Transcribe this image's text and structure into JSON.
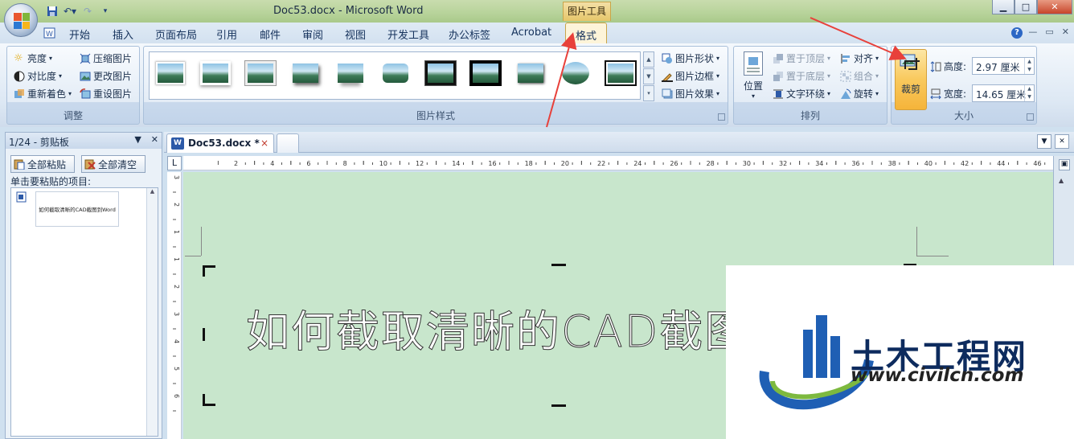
{
  "window": {
    "title": "Doc53.docx - Microsoft Word",
    "context_tools": "图片工具"
  },
  "tabs": [
    "开始",
    "插入",
    "页面布局",
    "引用",
    "邮件",
    "审阅",
    "视图",
    "开发工具",
    "办公标签",
    "Acrobat"
  ],
  "active_tab": "格式",
  "ribbon": {
    "adjust": {
      "label": "调整",
      "brightness": "亮度",
      "contrast": "对比度",
      "recolor": "重新着色",
      "compress": "压缩图片",
      "change": "更改图片",
      "reset": "重设图片"
    },
    "styles": {
      "label": "图片样式",
      "shape": "图片形状",
      "border": "图片边框",
      "effects": "图片效果"
    },
    "arrange": {
      "label": "排列",
      "position": "位置",
      "bring_front": "置于顶层",
      "send_back": "置于底层",
      "wrap": "文字环绕",
      "align": "对齐",
      "group": "组合",
      "rotate": "旋转"
    },
    "size": {
      "label": "大小",
      "crop": "裁剪",
      "height_label": "高度:",
      "height_value": "2.97 厘米",
      "width_label": "宽度:",
      "width_value": "14.65 厘米"
    }
  },
  "clipboard": {
    "header": "1/24 - 剪贴板",
    "paste_all": "全部粘贴",
    "clear_all": "全部清空",
    "hint": "单击要粘贴的项目:",
    "item_text": "如何截取清晰的CAD截图到Word"
  },
  "document": {
    "tab_name": "Doc53.docx *",
    "tab_close": "×",
    "body_text": "如何截取清晰的CAD截图到"
  },
  "ruler": {
    "h_marks": [
      "2",
      "4",
      "6",
      "8",
      "10",
      "12",
      "14",
      "16",
      "18",
      "20",
      "22",
      "24",
      "26",
      "28",
      "30",
      "32",
      "34",
      "36",
      "38",
      "40",
      "42",
      "44",
      "46"
    ],
    "v_marks": [
      "3",
      "2",
      "1",
      "1",
      "2",
      "3",
      "4",
      "5",
      "6"
    ]
  },
  "watermark": {
    "name": "土木工程网",
    "url": "www.civilcn.com"
  },
  "colors": {
    "accent_red": "#e8403a",
    "doc_bg": "#c8e6cc",
    "ribbon_blue": "#dde8f4"
  }
}
